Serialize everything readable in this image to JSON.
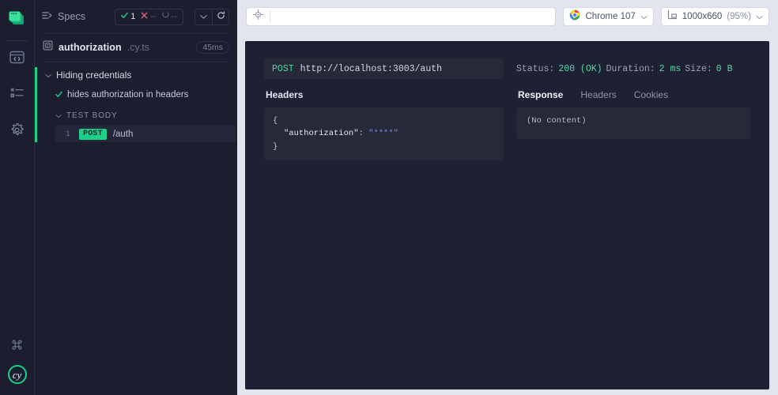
{
  "rail": {
    "logo_icon": "cypress-stacked-windows-icon",
    "items": [
      {
        "name": "specs-browser",
        "icon": "code-window-icon"
      },
      {
        "name": "runs",
        "icon": "list-runs-icon"
      },
      {
        "name": "settings",
        "icon": "gear-icon"
      }
    ],
    "keyboard_shortcut_icon": "command-key-icon",
    "cy_badge": "cy"
  },
  "sidebar": {
    "title": "Specs",
    "title_icon": "specs-list-icon",
    "stats": {
      "passed": "1",
      "failed": "--",
      "pending": "--"
    },
    "controls": {
      "collapse_icon": "chevron-down-icon",
      "rerun_icon": "reload-icon"
    },
    "spec": {
      "icon": "file-document-icon",
      "name": "authorization",
      "extension": ".cy.ts",
      "duration": "45ms"
    },
    "tree": {
      "suite": "Hiding credentials",
      "test": "hides authorization in headers",
      "body_label": "TEST BODY",
      "command": {
        "number": "1",
        "method": "POST",
        "url": "/auth"
      }
    }
  },
  "topbar": {
    "selector_playground_icon": "crosshair-target-icon",
    "url_value": "",
    "url_placeholder": "",
    "browser": {
      "icon": "chrome-logo-icon",
      "label": "Chrome 107",
      "chevron": "chevron-down-icon"
    },
    "viewport": {
      "icon": "viewport-size-icon",
      "size": "1000x660",
      "scale": "(95%)",
      "chevron": "chevron-down-icon"
    }
  },
  "preview": {
    "request": {
      "method": "POST",
      "url": "http://localhost:3003/auth",
      "headers_label": "Headers",
      "json": {
        "open": "{",
        "key": "\"authorization\"",
        "colon": ":",
        "value": "\"****\"",
        "close": "}"
      }
    },
    "response": {
      "status_label": "Status:",
      "status_value": "200 (OK)",
      "duration_label": "Duration:",
      "duration_value": "2 ms",
      "size_label": "Size:",
      "size_value": "0 B",
      "tabs": [
        {
          "label": "Response",
          "active": true
        },
        {
          "label": "Headers",
          "active": false
        },
        {
          "label": "Cookies",
          "active": false
        }
      ],
      "body": "(No content)"
    }
  },
  "colors": {
    "accent_green": "#1cd08a",
    "panel_bg": "#1e2133",
    "sidebar_bg": "#1b1e2e",
    "page_bg": "#e3e5ee"
  }
}
